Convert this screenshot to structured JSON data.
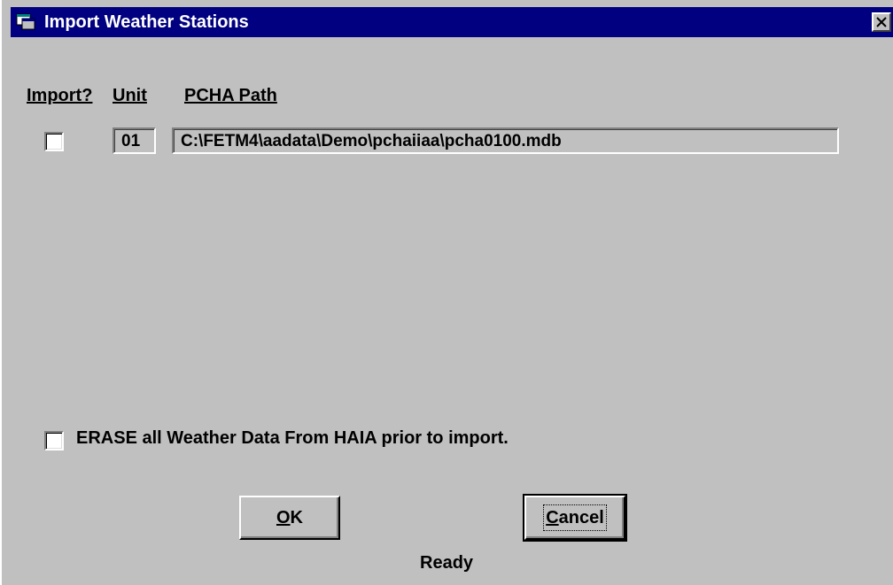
{
  "window": {
    "title": "Import Weather Stations",
    "title_icon": "app-window-icon",
    "close_icon": "close-icon"
  },
  "columns": {
    "import": "Import?",
    "unit": "Unit",
    "path": "PCHA Path"
  },
  "rows": [
    {
      "checked": false,
      "unit": "01",
      "path": "C:\\FETM4\\aadata\\Demo\\pchaiiaa\\pcha0100.mdb"
    }
  ],
  "erase_option": {
    "checked": false,
    "label": "ERASE all Weather Data From HAIA prior to import."
  },
  "buttons": {
    "ok_mnemonic": "O",
    "ok_rest": "K",
    "cancel_mnemonic": "C",
    "cancel_rest": "ancel"
  },
  "status": "Ready"
}
